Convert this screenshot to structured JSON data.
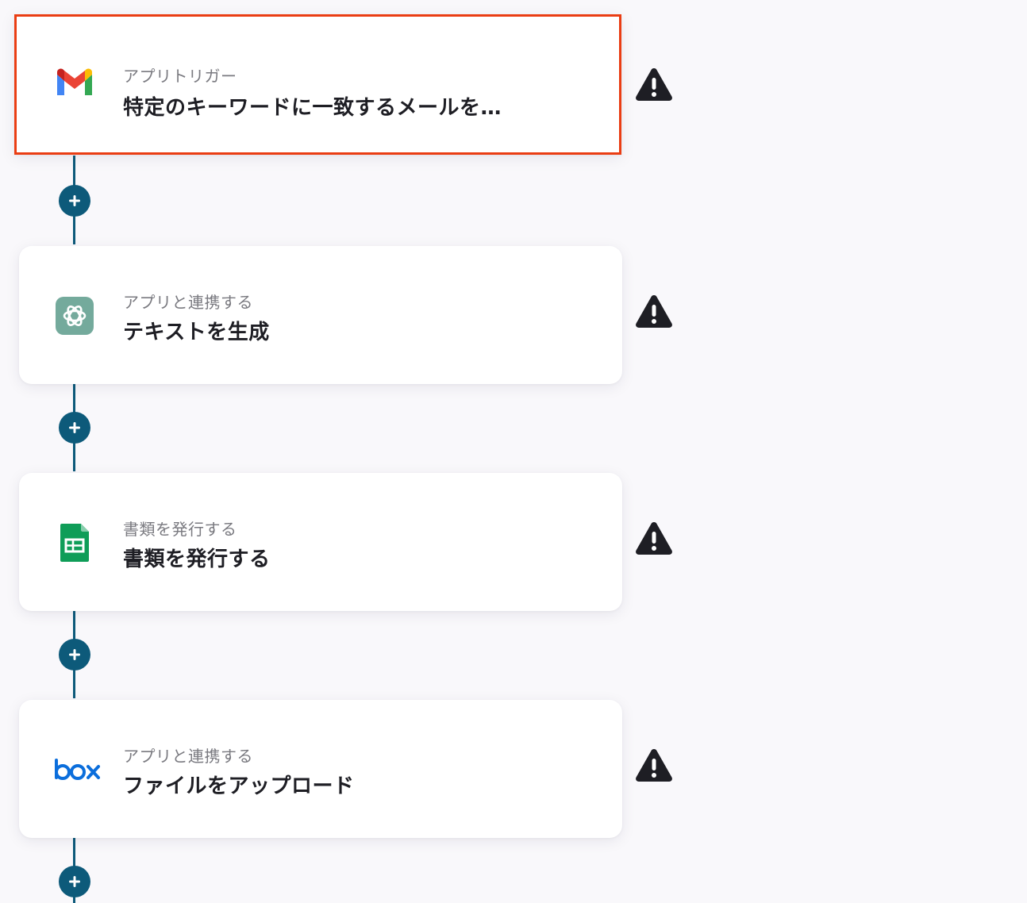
{
  "steps": [
    {
      "subtitle": "アプリトリガー",
      "title": "特定のキーワードに一致するメールを…",
      "icon": "gmail-icon",
      "selected": true
    },
    {
      "subtitle": "アプリと連携する",
      "title": "テキストを生成",
      "icon": "chatgpt-icon",
      "selected": false
    },
    {
      "subtitle": "書類を発行する",
      "title": "書類を発行する",
      "icon": "google-sheets-icon",
      "selected": false
    },
    {
      "subtitle": "アプリと連携する",
      "title": "ファイルをアップロード",
      "icon": "box-icon",
      "selected": false
    }
  ],
  "colors": {
    "background": "#f9f8fb",
    "connector": "#0d5a7a",
    "selected_border": "#ea3d13",
    "warning": "#1e1e24"
  },
  "add_step_icon": "plus-icon",
  "warning_icon": "warning-icon"
}
